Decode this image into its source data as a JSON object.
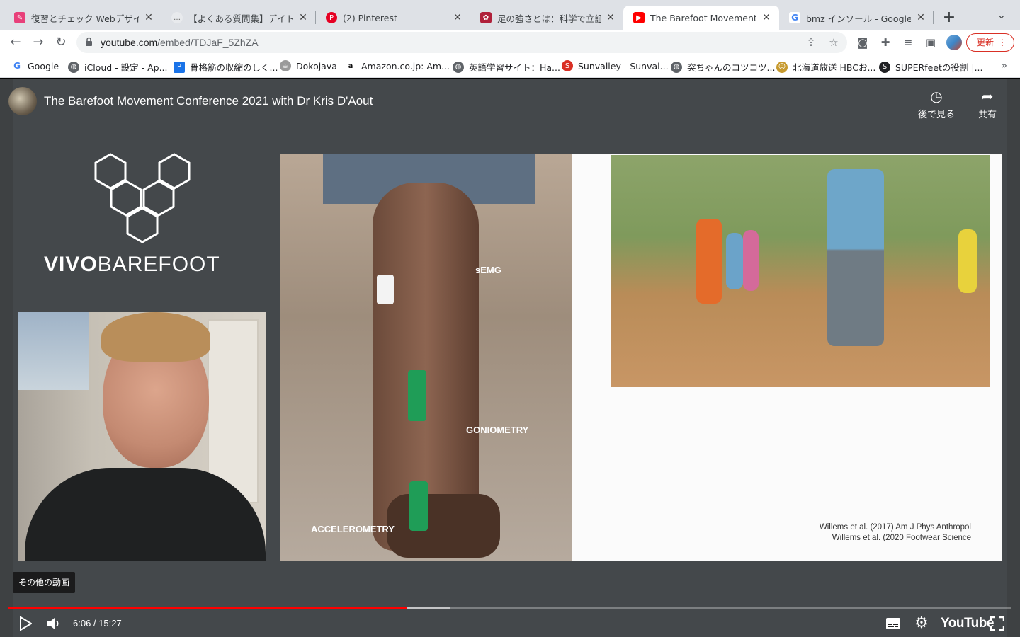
{
  "tabs": [
    {
      "title": "復習とチェック Webデザイン",
      "active": false,
      "favicon_color": "#e8407a"
    },
    {
      "title": "【よくある質問集】デイトラ",
      "active": false,
      "favicon_color": "#9aa0a6"
    },
    {
      "title": "(2) Pinterest",
      "active": false,
      "favicon_color": "#e60023"
    },
    {
      "title": "足の強さとは：科学で立証され",
      "active": false,
      "favicon_color": "#b0203a"
    },
    {
      "title": "The Barefoot Movement Co",
      "active": true,
      "favicon_color": "#ff0000"
    },
    {
      "title": "bmz インソール - Google Se",
      "active": false,
      "favicon_color": "#4285f4"
    }
  ],
  "toolbar": {
    "url_host": "youtube.com",
    "url_path": "/embed/TDJaF_5ZhZA",
    "update_label": "更新"
  },
  "bookmarks": [
    {
      "label": "Google",
      "icon": "google-icon",
      "color": "#4285f4"
    },
    {
      "label": "iCloud - 設定 - Ap...",
      "icon": "globe-icon",
      "color": "#5f6368"
    },
    {
      "label": "骨格筋の収縮のしく...",
      "icon": "doc-icon",
      "color": "#1a73e8"
    },
    {
      "label": "Dokojava",
      "icon": "java-icon",
      "color": "#7a7a7a"
    },
    {
      "label": "Amazon.co.jp: Am...",
      "icon": "amazon-icon",
      "color": "#111111"
    },
    {
      "label": "英語学習サイト：Ha...",
      "icon": "globe-icon",
      "color": "#5f6368"
    },
    {
      "label": "Sunvalley - Sunval...",
      "icon": "sunvalley-icon",
      "color": "#d93025"
    },
    {
      "label": "突ちゃんのコツコツ...",
      "icon": "globe-icon",
      "color": "#5f6368"
    },
    {
      "label": "北海道放送 HBCお...",
      "icon": "hbc-icon",
      "color": "#c79a2e"
    },
    {
      "label": "SUPERfeetの役割 |...",
      "icon": "superfeet-icon",
      "color": "#202124"
    }
  ],
  "video": {
    "title": "The Barefoot Movement Conference 2021 with Dr Kris D'Aout",
    "watch_later": "後で見る",
    "share": "共有",
    "brand_bold": "VIVO",
    "brand_light": "BAREFOOT",
    "labels": {
      "semg": "sEMG",
      "goniometry": "GONIOMETRY",
      "accelerometry": "ACCELEROMETRY"
    },
    "citation_1": "Willems et al. (2017) Am J Phys Anthropol",
    "citation_2": "Willems et al. (2020 Footwear Science",
    "more_videos": "その他の動画",
    "time_display": "6:06 / 15:27",
    "progress_played": 0.397,
    "progress_buffered": 0.44,
    "youtube_logo": "YouTube"
  }
}
